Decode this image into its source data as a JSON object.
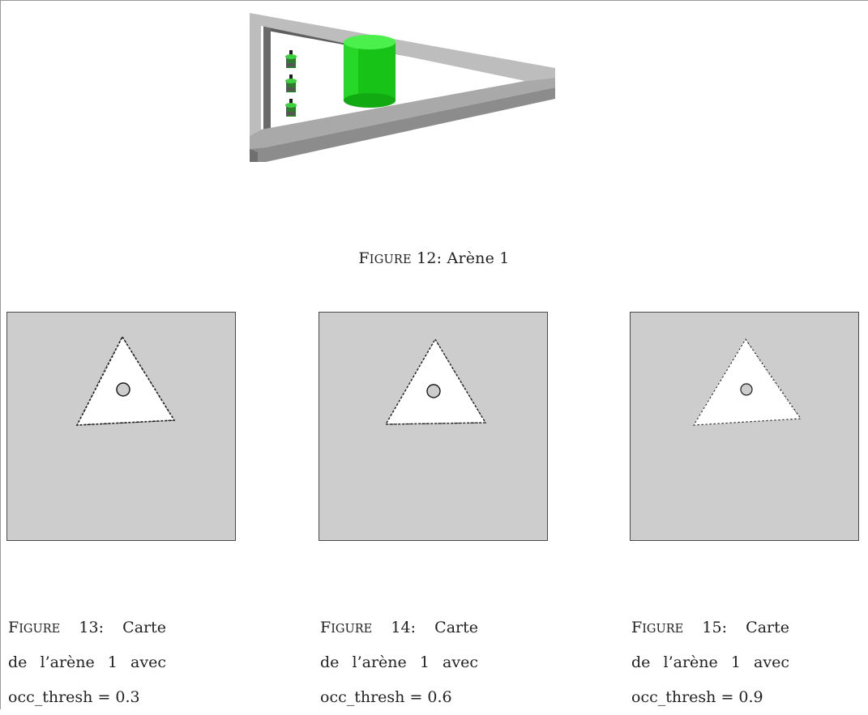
{
  "figure12": {
    "label_first": "F",
    "label_rest": "igure",
    "number": "12:",
    "title": "Arène 1"
  },
  "figures": [
    {
      "label_first": "F",
      "label_rest": "igure",
      "number": "13:",
      "line1_word": "Carte",
      "line2": [
        "de",
        "l’arène",
        "1",
        "avec"
      ],
      "line3": "occ_thresh = 0.3",
      "occ_thresh": 0.3
    },
    {
      "label_first": "F",
      "label_rest": "igure",
      "number": "14:",
      "line1_word": "Carte",
      "line2": [
        "de",
        "l’arène",
        "1",
        "avec"
      ],
      "line3": "occ_thresh = 0.6",
      "occ_thresh": 0.6
    },
    {
      "label_first": "F",
      "label_rest": "igure",
      "number": "15:",
      "line1_word": "Carte",
      "line2": [
        "de",
        "l’arène",
        "1",
        "avec"
      ],
      "line3": "occ_thresh = 0.9",
      "occ_thresh": 0.9
    }
  ],
  "colors": {
    "wall_light": "#bdbdbd",
    "wall_mid": "#9b9b9b",
    "wall_dark": "#5e5e5e",
    "cylinder_top": "#4cf04c",
    "cylinder_body": "#16c316",
    "map_background": "#cdcdcd",
    "map_free": "#ffffff",
    "map_obstacle": "#1a1a1a"
  }
}
